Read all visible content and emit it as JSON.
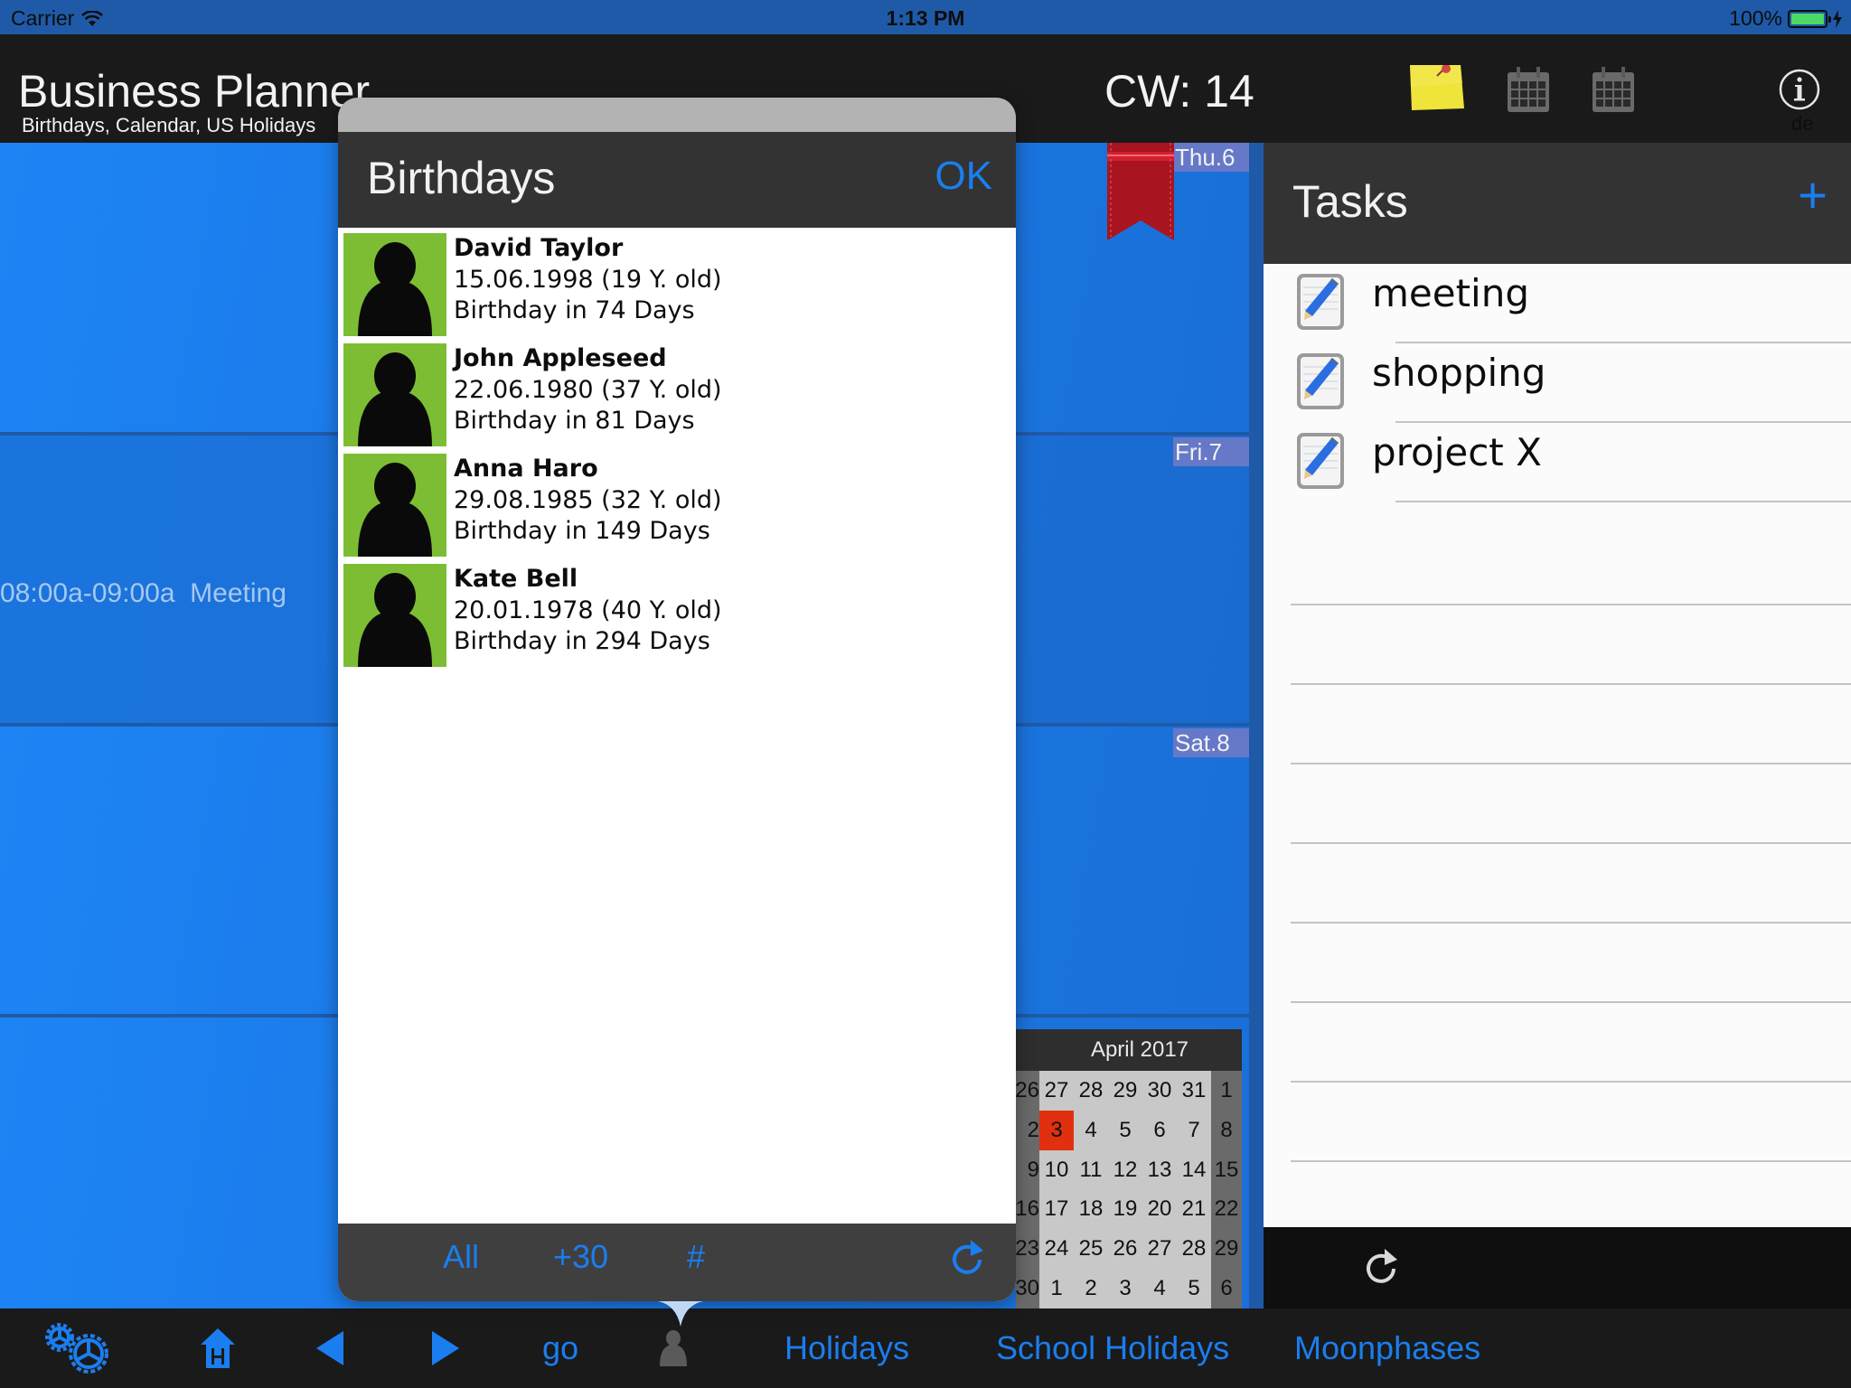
{
  "status_bar": {
    "carrier": "Carrier",
    "time": "1:13 PM",
    "battery": "100%",
    "battery_level_percent": 100
  },
  "header": {
    "title": "Business Planner",
    "subtitle": "Birthdays, Calendar, US Holidays",
    "calendar_week": "CW: 14",
    "language": "de",
    "icons": [
      "sticky-note-icon",
      "calendar-icon",
      "calendar-icon",
      "info-icon"
    ]
  },
  "calendar": {
    "days": [
      {
        "label": "Thu.6",
        "bookmarked": true
      },
      {
        "label": "Fri.7"
      },
      {
        "label": "Sat.8"
      }
    ],
    "event": {
      "time": "08:00a-09:00a",
      "title": "Meeting",
      "text": "08:00a-09:00a  Meeting"
    },
    "colors": {
      "row": "#1c78e8",
      "divider": "#1f5aa8",
      "day_label_bg": "#6678c8",
      "ribbon": "#a8141f"
    }
  },
  "mini_calendar": {
    "title": "April 2017",
    "today": 3,
    "weeks": [
      {
        "wk": "26",
        "days": [
          "27",
          "28",
          "29",
          "30",
          "31",
          "1"
        ]
      },
      {
        "wk": "2",
        "days": [
          "3",
          "4",
          "5",
          "6",
          "7",
          "8"
        ]
      },
      {
        "wk": "9",
        "days": [
          "10",
          "11",
          "12",
          "13",
          "14",
          "15"
        ]
      },
      {
        "wk": "16",
        "days": [
          "17",
          "18",
          "19",
          "20",
          "21",
          "22"
        ]
      },
      {
        "wk": "23",
        "days": [
          "24",
          "25",
          "26",
          "27",
          "28",
          "29"
        ]
      },
      {
        "wk": "30",
        "days": [
          "1",
          "2",
          "3",
          "4",
          "5",
          "6"
        ]
      }
    ],
    "colors": {
      "today": "#e03010",
      "weekday_bg": "#c8c8c8",
      "weekend_bg": "#6a6a6a"
    }
  },
  "tasks": {
    "title": "Tasks",
    "add_label": "+",
    "items": [
      {
        "label": "meeting"
      },
      {
        "label": "shopping"
      },
      {
        "label": "project X"
      }
    ]
  },
  "birthdays_popover": {
    "title": "Birthdays",
    "ok_label": "OK",
    "entries": [
      {
        "name": "David Taylor",
        "date_age": "15.06.1998 (19 Y. old)",
        "countdown": "Birthday in 74 Days"
      },
      {
        "name": "John Appleseed",
        "date_age": "22.06.1980 (37 Y. old)",
        "countdown": "Birthday in 81 Days"
      },
      {
        "name": "Anna Haro",
        "date_age": "29.08.1985 (32 Y. old)",
        "countdown": "Birthday in 149 Days"
      },
      {
        "name": "Kate Bell",
        "date_age": "20.01.1978 (40 Y. old)",
        "countdown": "Birthday in 294 Days"
      }
    ],
    "footer": {
      "all_label": "All",
      "plus30_label": "+30",
      "hash_label": "#"
    },
    "colors": {
      "avatar_bg": "#7dbd34",
      "accent": "#1a7ef0"
    }
  },
  "toolbar": {
    "go_label": "go",
    "holidays_label": "Holidays",
    "school_holidays_label": "School Holidays",
    "moonphases_label": "Moonphases",
    "accent": "#1a7ef0"
  }
}
